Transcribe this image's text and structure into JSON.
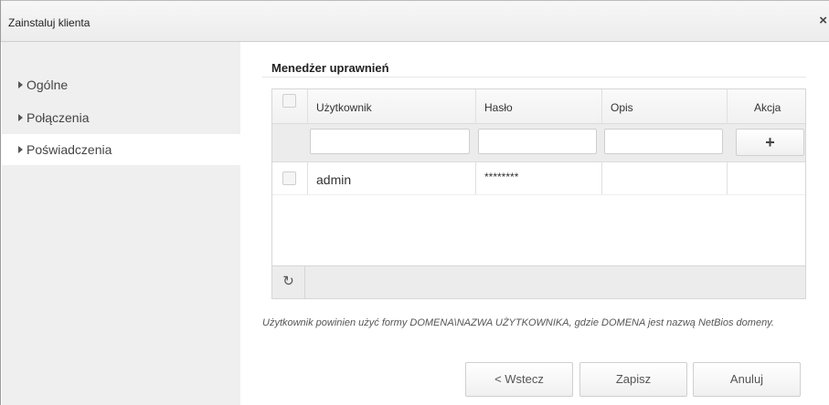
{
  "dialog": {
    "title": "Zainstaluj klienta",
    "close_icon": "×"
  },
  "sidebar": {
    "items": [
      {
        "label": "Ogólne",
        "active": false
      },
      {
        "label": "Połączenia",
        "active": false
      },
      {
        "label": "Poświadczenia",
        "active": true
      }
    ]
  },
  "section": {
    "title": "Menedżer uprawnień"
  },
  "grid": {
    "columns": [
      "Użytkownik",
      "Hasło",
      "Opis",
      "Akcja"
    ],
    "filters": {
      "user": "",
      "password": "",
      "description": ""
    },
    "add_icon": "+",
    "rows": [
      {
        "user": "admin",
        "password": "********",
        "description": "",
        "action": ""
      }
    ],
    "refresh_icon": "↻"
  },
  "hint": "Użytkownik powinien użyć formy DOMENA\\NAZWA UŻYTKOWNIKA, gdzie DOMENA jest nazwą NetBios domeny.",
  "buttons": {
    "back": "< Wstecz",
    "save": "Zapisz",
    "cancel": "Anuluj"
  }
}
